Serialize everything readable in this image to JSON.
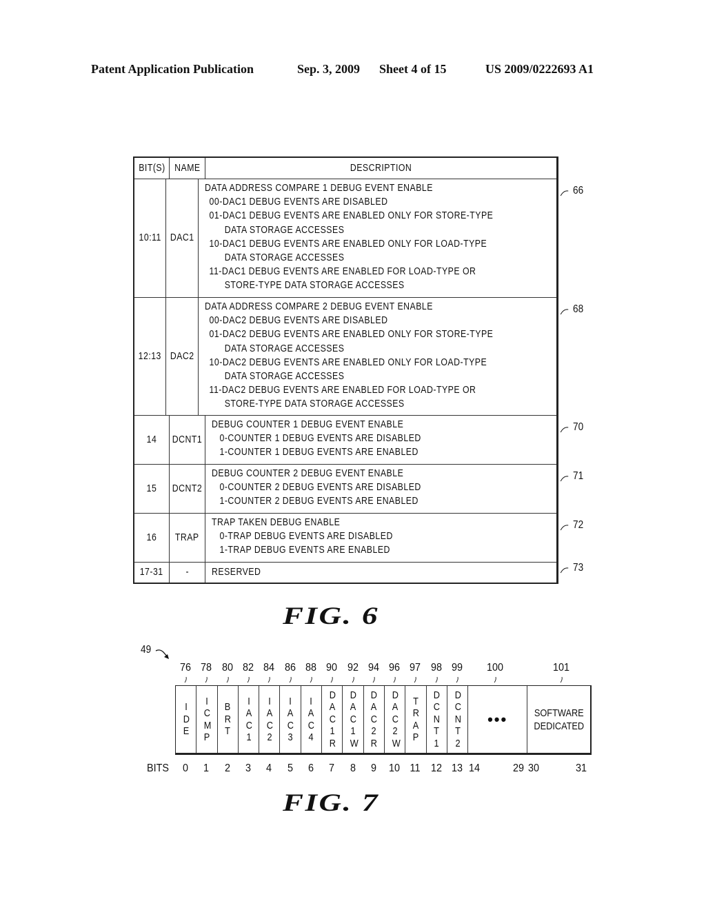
{
  "header": {
    "publication": "Patent Application Publication",
    "date": "Sep. 3, 2009",
    "sheet": "Sheet 4 of 15",
    "number": "US 2009/0222693 A1"
  },
  "fig6": {
    "caption": "FIG. 6",
    "columns": [
      "BIT(S)",
      "NAME",
      "DESCRIPTION"
    ],
    "rows": [
      {
        "bits": "10:11",
        "name": "DAC1",
        "ref": "66",
        "lines": [
          {
            "text": "DATA ADDRESS COMPARE 1 DEBUG EVENT ENABLE",
            "indent": 0
          },
          {
            "text": "00-DAC1 DEBUG EVENTS ARE DISABLED",
            "indent": 1
          },
          {
            "text": "01-DAC1 DEBUG EVENTS ARE ENABLED ONLY FOR STORE-TYPE",
            "indent": 1
          },
          {
            "text": "DATA STORAGE ACCESSES",
            "indent": 2
          },
          {
            "text": "10-DAC1 DEBUG EVENTS ARE ENABLED ONLY FOR LOAD-TYPE",
            "indent": 1
          },
          {
            "text": "DATA STORAGE ACCESSES",
            "indent": 2
          },
          {
            "text": "11-DAC1 DEBUG EVENTS ARE ENABLED FOR LOAD-TYPE OR",
            "indent": 1
          },
          {
            "text": "STORE-TYPE DATA STORAGE ACCESSES",
            "indent": 2
          }
        ]
      },
      {
        "bits": "12:13",
        "name": "DAC2",
        "ref": "68",
        "lines": [
          {
            "text": "DATA ADDRESS COMPARE 2 DEBUG EVENT ENABLE",
            "indent": 0
          },
          {
            "text": "00-DAC2 DEBUG EVENTS ARE DISABLED",
            "indent": 1
          },
          {
            "text": "01-DAC2 DEBUG EVENTS ARE ENABLED ONLY FOR STORE-TYPE",
            "indent": 1
          },
          {
            "text": "DATA STORAGE ACCESSES",
            "indent": 2
          },
          {
            "text": "10-DAC2 DEBUG EVENTS ARE ENABLED ONLY FOR LOAD-TYPE",
            "indent": 1
          },
          {
            "text": "DATA STORAGE ACCESSES",
            "indent": 2
          },
          {
            "text": "11-DAC2 DEBUG EVENTS ARE ENABLED FOR LOAD-TYPE OR",
            "indent": 1
          },
          {
            "text": "STORE-TYPE DATA STORAGE ACCESSES",
            "indent": 2
          }
        ]
      },
      {
        "bits": "14",
        "name": "DCNT1",
        "ref": "70",
        "lines": [
          {
            "text": "DEBUG COUNTER 1 DEBUG EVENT ENABLE",
            "indent": 0
          },
          {
            "text": "0-COUNTER 1 DEBUG EVENTS ARE DISABLED",
            "indent": 3
          },
          {
            "text": "1-COUNTER 1 DEBUG EVENTS ARE ENABLED",
            "indent": 3
          }
        ]
      },
      {
        "bits": "15",
        "name": "DCNT2",
        "ref": "71",
        "lines": [
          {
            "text": "DEBUG COUNTER 2 DEBUG EVENT ENABLE",
            "indent": 0
          },
          {
            "text": "0-COUNTER 2 DEBUG EVENTS ARE DISABLED",
            "indent": 3
          },
          {
            "text": "1-COUNTER 2 DEBUG EVENTS ARE ENABLED",
            "indent": 3
          }
        ]
      },
      {
        "bits": "16",
        "name": "TRAP",
        "ref": "72",
        "lines": [
          {
            "text": "TRAP TAKEN DEBUG ENABLE",
            "indent": 0
          },
          {
            "text": "0-TRAP DEBUG EVENTS ARE DISABLED",
            "indent": 3
          },
          {
            "text": "1-TRAP DEBUG EVENTS ARE ENABLED",
            "indent": 3
          }
        ]
      },
      {
        "bits": "17-31",
        "name": "-",
        "ref": "73",
        "lines": [
          {
            "text": "RESERVED",
            "indent": 0
          }
        ]
      }
    ]
  },
  "fig7": {
    "caption": "FIG. 7",
    "register_ref": "49",
    "bits_label": "BITS",
    "fields": [
      {
        "label": "IDE",
        "ref": "76",
        "bits": [
          "0"
        ]
      },
      {
        "label": "ICMP",
        "ref": "78",
        "bits": [
          "1"
        ]
      },
      {
        "label": "BRT",
        "ref": "80",
        "bits": [
          "2"
        ]
      },
      {
        "label": "IAC1",
        "ref": "82",
        "bits": [
          "3"
        ]
      },
      {
        "label": "IAC2",
        "ref": "84",
        "bits": [
          "4"
        ]
      },
      {
        "label": "IAC3",
        "ref": "86",
        "bits": [
          "5"
        ]
      },
      {
        "label": "IAC4",
        "ref": "88",
        "bits": [
          "6"
        ]
      },
      {
        "label": "DAC1R",
        "ref": "90",
        "bits": [
          "7"
        ]
      },
      {
        "label": "DAC1W",
        "ref": "92",
        "bits": [
          "8"
        ]
      },
      {
        "label": "DAC2R",
        "ref": "94",
        "bits": [
          "9"
        ]
      },
      {
        "label": "DAC2W",
        "ref": "96",
        "bits": [
          "10"
        ]
      },
      {
        "label": "TRAP",
        "ref": "97",
        "bits": [
          "11"
        ]
      },
      {
        "label": "DCNT1",
        "ref": "98",
        "bits": [
          "12"
        ]
      },
      {
        "label": "DCNT2",
        "ref": "99",
        "bits": [
          "13"
        ]
      },
      {
        "label": "...",
        "ref": "100",
        "bits": [
          "14",
          "29"
        ]
      },
      {
        "label": "SOFTWARE DEDICATED",
        "ref": "101",
        "bits": [
          "30",
          "31"
        ]
      }
    ]
  }
}
